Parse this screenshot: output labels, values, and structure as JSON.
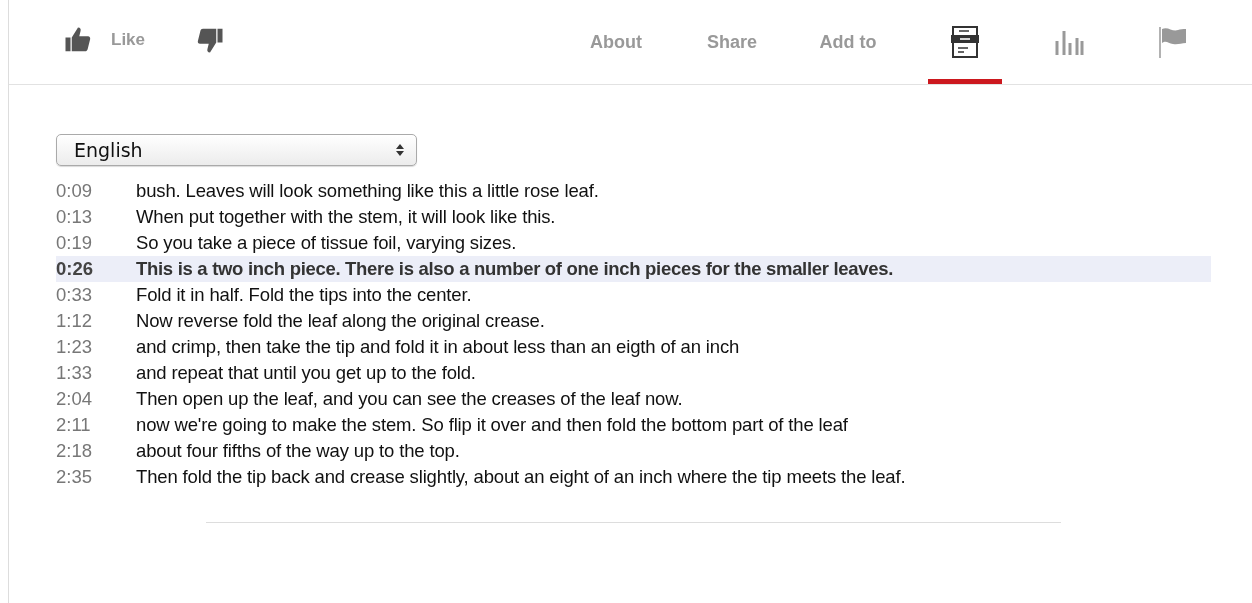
{
  "actions": {
    "like": {
      "label": "Like"
    }
  },
  "tabs": [
    {
      "kind": "text",
      "label": "About",
      "selected": false
    },
    {
      "kind": "text",
      "label": "Share",
      "selected": false
    },
    {
      "kind": "text",
      "label": "Add to",
      "selected": false
    },
    {
      "kind": "transcript",
      "selected": true
    },
    {
      "kind": "stats",
      "selected": false
    },
    {
      "kind": "flag",
      "selected": false
    }
  ],
  "language_select": {
    "value": "English"
  },
  "transcript": [
    {
      "time": "0:09",
      "text": "bush. Leaves will look something like this a little rose leaf.",
      "selected": false
    },
    {
      "time": "0:13",
      "text": "When put together with the stem, it will look like this.",
      "selected": false
    },
    {
      "time": "0:19",
      "text": "So you take a piece of tissue foil, varying sizes.",
      "selected": false
    },
    {
      "time": "0:26",
      "text": "This is a two inch piece. There is also a number of one inch pieces for the smaller leaves.",
      "selected": true
    },
    {
      "time": "0:33",
      "text": "Fold it in half. Fold the tips into the center.",
      "selected": false
    },
    {
      "time": "1:12",
      "text": "Now reverse fold the leaf along the original crease.",
      "selected": false
    },
    {
      "time": "1:23",
      "text": "and crimp, then take the tip and fold it in about less than an eigth of an inch",
      "selected": false
    },
    {
      "time": "1:33",
      "text": "and repeat that until you get up to the fold.",
      "selected": false
    },
    {
      "time": "2:04",
      "text": "Then open up the leaf, and you can see the creases of the leaf now.",
      "selected": false
    },
    {
      "time": "2:11",
      "text": "now we're going to make the stem. So flip it over and then fold the bottom part of the leaf",
      "selected": false
    },
    {
      "time": "2:18",
      "text": "about four fifths of the way up to the top.",
      "selected": false
    },
    {
      "time": "2:35",
      "text": "Then fold the tip back and crease slightly, about an eight of an inch where the tip meets the leaf.",
      "selected": false
    }
  ]
}
